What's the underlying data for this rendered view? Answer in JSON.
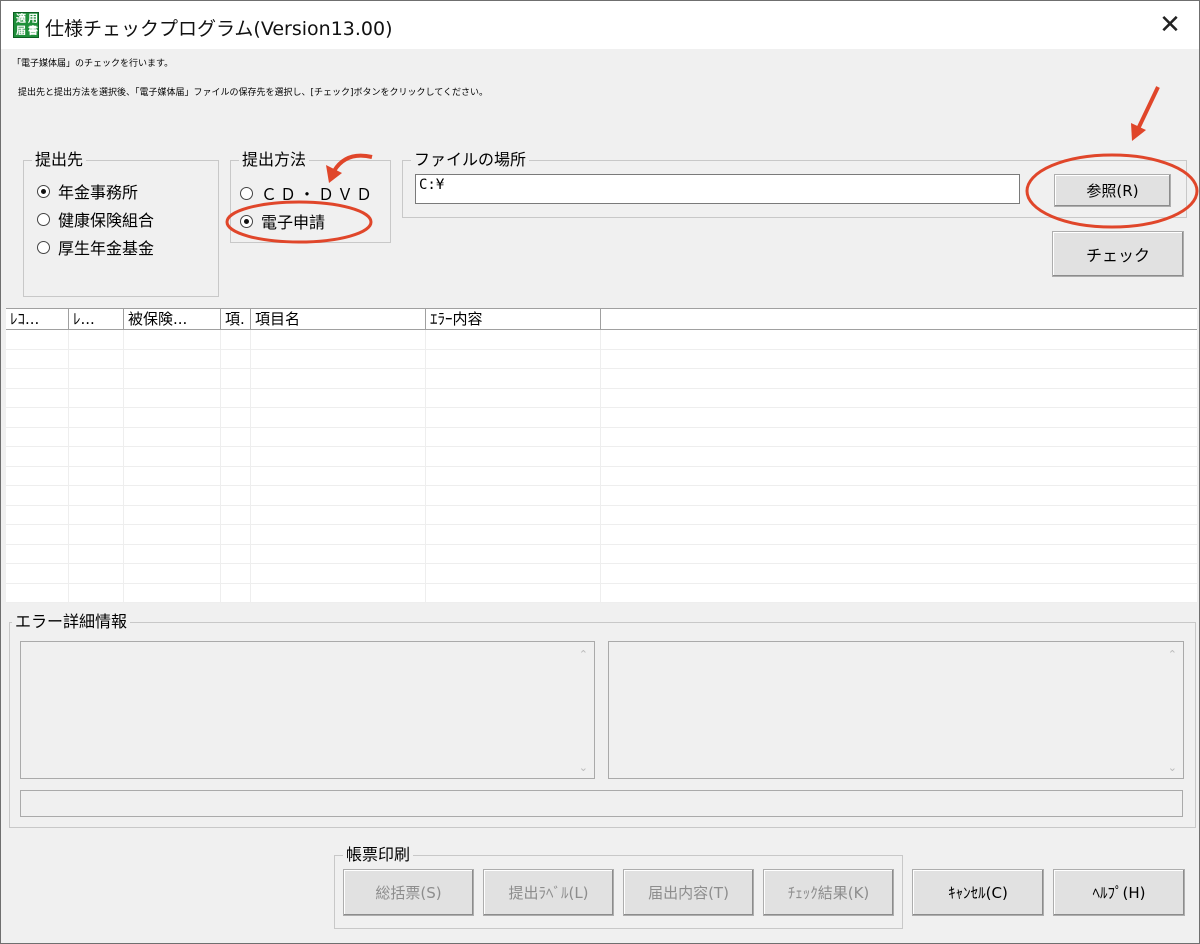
{
  "window": {
    "title": "仕様チェックプログラム(Version13.00)",
    "icon_text": [
      "適",
      "用",
      "届",
      "書"
    ]
  },
  "intro": {
    "line1": "「電子媒体届」のチェックを行います。",
    "line2": "提出先と提出方法を選択後、「電子媒体届」ファイルの保存先を選択し、[チェック]ボタンをクリックしてください。"
  },
  "destination": {
    "legend": "提出先",
    "options": [
      "年金事務所",
      "健康保険組合",
      "厚生年金基金"
    ],
    "selected": "年金事務所"
  },
  "method": {
    "legend": "提出方法",
    "options": [
      "ＣＤ・ＤＶＤ",
      "電子申請"
    ],
    "selected": "電子申請"
  },
  "file": {
    "legend": "ファイルの場所",
    "value": "C:¥",
    "browse_label": "参照(R)"
  },
  "check_label": "チェック",
  "grid": {
    "columns": [
      "ﾚｺ...",
      "ﾚ...",
      "被保険...",
      "項.",
      "項目名",
      "ｴﾗｰ内容"
    ]
  },
  "error_detail": {
    "legend": "エラー詳細情報"
  },
  "print": {
    "legend": "帳票印刷",
    "buttons": [
      "総括票(S)",
      "提出ﾗﾍﾞﾙ(L)",
      "届出内容(T)",
      "ﾁｪｯｸ結果(K)"
    ]
  },
  "cancel_label": "ｷｬﾝｾﾙ(C)",
  "help_label": "ﾍﾙﾌﾟ(H)",
  "colors": {
    "annotation": "#e0462a",
    "icon_green": "#1f8f3a"
  }
}
